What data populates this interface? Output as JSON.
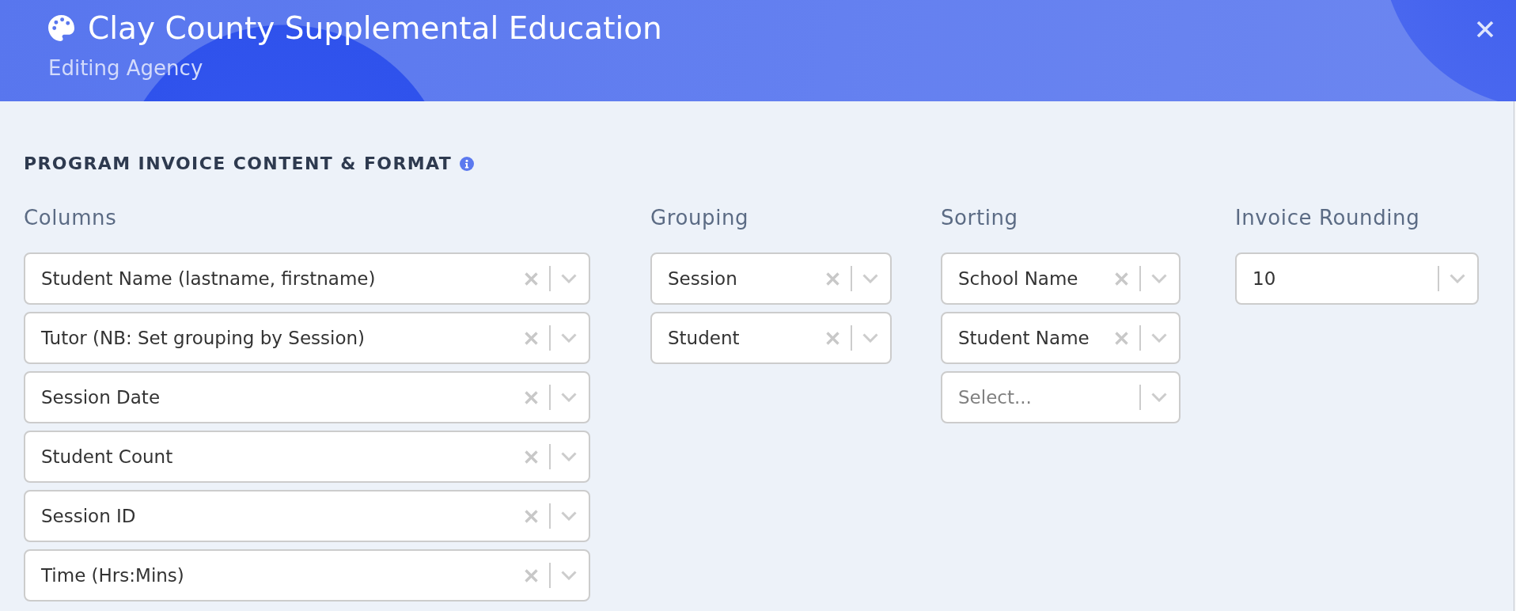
{
  "header": {
    "title": "Clay County Supplemental Education",
    "subtitle": "Editing Agency"
  },
  "section": {
    "title": "PROGRAM INVOICE CONTENT & FORMAT"
  },
  "groups": [
    {
      "label": "Columns",
      "selects": [
        {
          "value": "Student Name (lastname, firstname)",
          "clearable": true
        },
        {
          "value": "Tutor (NB: Set grouping by Session)",
          "clearable": true
        },
        {
          "value": "Session Date",
          "clearable": true
        },
        {
          "value": "Student Count",
          "clearable": true
        },
        {
          "value": "Session ID",
          "clearable": true
        },
        {
          "value": "Time (Hrs:Mins)",
          "clearable": true
        }
      ]
    },
    {
      "label": "Grouping",
      "selects": [
        {
          "value": "Session",
          "clearable": true
        },
        {
          "value": "Student",
          "clearable": true
        }
      ]
    },
    {
      "label": "Sorting",
      "selects": [
        {
          "value": "School Name",
          "clearable": true
        },
        {
          "value": "Student Name",
          "clearable": true
        },
        {
          "placeholder": "Select...",
          "clearable": false
        }
      ]
    },
    {
      "label": "Invoice Rounding",
      "selects": [
        {
          "value": "10",
          "clearable": false
        }
      ]
    }
  ]
}
